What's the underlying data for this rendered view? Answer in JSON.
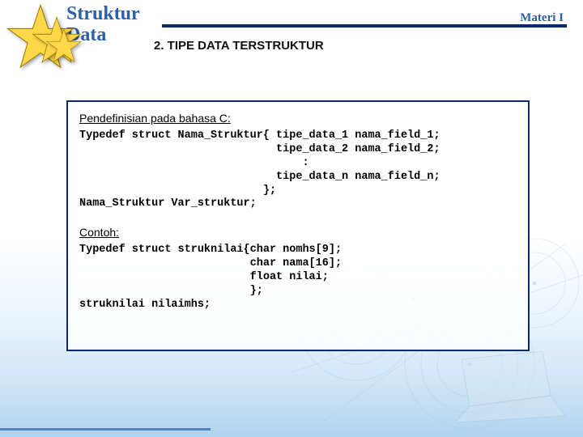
{
  "header": {
    "title_line1": "Struktur",
    "title_line2": "Data",
    "right_label": "Materi I",
    "section": "2.  TIPE DATA TERSTRUKTUR"
  },
  "panel": {
    "definition_heading": "Pendefinisian pada bahasa C:",
    "definition_code": "Typedef struct Nama_Struktur{ tipe_data_1 nama_field_1;\n                              tipe_data_2 nama_field_2;\n                                  :\n                              tipe_data_n nama_field_n;\n                            };\nNama_Struktur Var_struktur;",
    "example_heading": "Contoh:",
    "example_code": "Typedef struct struknilai{char nomhs[9];\n                          char nama[16];\n                          float nilai;\n                          };\nstruknilai nilaimhs;"
  },
  "colors": {
    "navy": "#0a2a66",
    "blue": "#2b5fa8",
    "star_fill": "#ffd84a",
    "star_stroke": "#9a7d00"
  }
}
